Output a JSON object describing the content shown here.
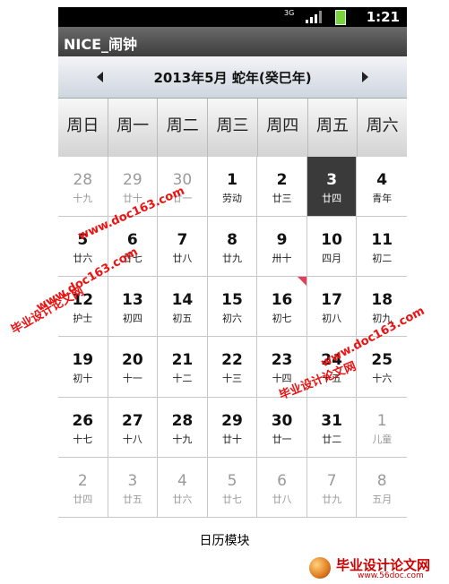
{
  "status": {
    "network": "3G",
    "time": "1:21",
    "battery_color": "#7bd23a"
  },
  "app": {
    "title": "NICE_闹钟"
  },
  "month": {
    "label": "2013年5月   蛇年(癸巳年)"
  },
  "weekdays": [
    "周日",
    "周一",
    "周二",
    "周三",
    "周四",
    "周五",
    "周六"
  ],
  "days": [
    {
      "d": "28",
      "l": "十九",
      "other": true
    },
    {
      "d": "29",
      "l": "廿十",
      "other": true
    },
    {
      "d": "30",
      "l": "廿一",
      "other": true
    },
    {
      "d": "1",
      "l": "劳动"
    },
    {
      "d": "2",
      "l": "廿三"
    },
    {
      "d": "3",
      "l": "廿四",
      "today": true
    },
    {
      "d": "4",
      "l": "青年"
    },
    {
      "d": "5",
      "l": "廿六"
    },
    {
      "d": "6",
      "l": "廿七"
    },
    {
      "d": "7",
      "l": "廿八"
    },
    {
      "d": "8",
      "l": "廿九"
    },
    {
      "d": "9",
      "l": "卅十"
    },
    {
      "d": "10",
      "l": "四月"
    },
    {
      "d": "11",
      "l": "初二"
    },
    {
      "d": "12",
      "l": "护士"
    },
    {
      "d": "13",
      "l": "初四"
    },
    {
      "d": "14",
      "l": "初五"
    },
    {
      "d": "15",
      "l": "初六"
    },
    {
      "d": "16",
      "l": "初七",
      "marker": true
    },
    {
      "d": "17",
      "l": "初八"
    },
    {
      "d": "18",
      "l": "初九"
    },
    {
      "d": "19",
      "l": "初十"
    },
    {
      "d": "20",
      "l": "十一"
    },
    {
      "d": "21",
      "l": "十二"
    },
    {
      "d": "22",
      "l": "十三"
    },
    {
      "d": "23",
      "l": "十四"
    },
    {
      "d": "24",
      "l": "十五"
    },
    {
      "d": "25",
      "l": "十六"
    },
    {
      "d": "26",
      "l": "十七"
    },
    {
      "d": "27",
      "l": "十八"
    },
    {
      "d": "28",
      "l": "十九"
    },
    {
      "d": "29",
      "l": "廿十"
    },
    {
      "d": "30",
      "l": "廿一"
    },
    {
      "d": "31",
      "l": "廿二"
    },
    {
      "d": "1",
      "l": "儿童",
      "other": true
    },
    {
      "d": "2",
      "l": "廿四",
      "other": true
    },
    {
      "d": "3",
      "l": "廿五",
      "other": true
    },
    {
      "d": "4",
      "l": "廿六",
      "other": true
    },
    {
      "d": "5",
      "l": "廿七",
      "other": true
    },
    {
      "d": "6",
      "l": "廿八",
      "other": true
    },
    {
      "d": "7",
      "l": "廿九",
      "other": true
    },
    {
      "d": "8",
      "l": "五月",
      "other": true
    }
  ],
  "caption": "日历模块",
  "watermark": {
    "cn": "毕业设计论文网",
    "url": "www.doc163.com",
    "url2": "www.56doc.com"
  },
  "colors": {
    "today_bg": "#3a3a3a",
    "marker": "#e0405a",
    "watermark": "#e11"
  }
}
